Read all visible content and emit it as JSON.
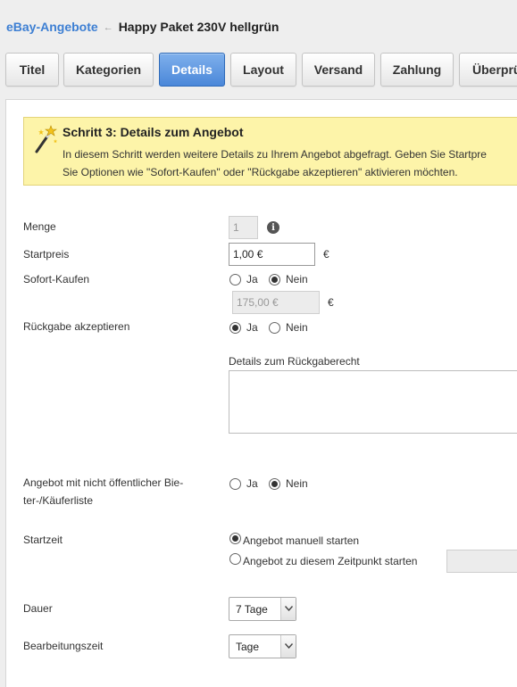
{
  "breadcrumb": {
    "root": "eBay-Angebote",
    "separator": "←",
    "current": "Happy Paket 230V hellgrün"
  },
  "tabs": [
    {
      "label": "Titel",
      "active": false
    },
    {
      "label": "Kategorien",
      "active": false
    },
    {
      "label": "Details",
      "active": true
    },
    {
      "label": "Layout",
      "active": false
    },
    {
      "label": "Versand",
      "active": false
    },
    {
      "label": "Zahlung",
      "active": false
    },
    {
      "label": "Überprü",
      "active": false
    }
  ],
  "info": {
    "title": "Schritt 3: Details zum Angebot",
    "line1": "In diesem Schritt werden weitere Details zu Ihrem Angebot abgefragt. Geben Sie Startpre",
    "line2": "Sie Optionen wie \"Sofort-Kaufen\" oder \"Rückgabe akzeptieren\" aktivieren möchten."
  },
  "form": {
    "menge": {
      "label": "Menge",
      "value": "1",
      "info_icon": "info-icon"
    },
    "startpreis": {
      "label": "Startpreis",
      "value": "1,00 €",
      "unit": "€"
    },
    "sofort": {
      "label": "Sofort-Kaufen",
      "option_yes": "Ja",
      "option_no": "Nein",
      "selected": "Nein",
      "price_value": "175,00 €",
      "unit": "€"
    },
    "rueckgabe": {
      "label": "Rückgabe akzeptieren",
      "option_yes": "Ja",
      "option_no": "Nein",
      "selected": "Ja",
      "details_label": "Details zum Rückgaberecht",
      "details_value": ""
    },
    "bieterliste": {
      "label_line1": "Angebot mit nicht öffentlicher Bie-",
      "label_line2": "ter-/Käuferliste",
      "option_yes": "Ja",
      "option_no": "Nein",
      "selected": "Nein"
    },
    "startzeit": {
      "label": "Startzeit",
      "option_manual": "Angebot manuell starten",
      "option_scheduled": "Angebot zu diesem Zeitpunkt starten",
      "selected": "manual",
      "scheduled_value": ""
    },
    "dauer": {
      "label": "Dauer",
      "value": "7 Tage"
    },
    "bearbeitungszeit": {
      "label": "Bearbeitungszeit",
      "value": "Tage"
    }
  },
  "colors": {
    "link": "#3d7fd3",
    "active_tab": "#4a87d9",
    "info_bg": "#fdf4a9"
  }
}
